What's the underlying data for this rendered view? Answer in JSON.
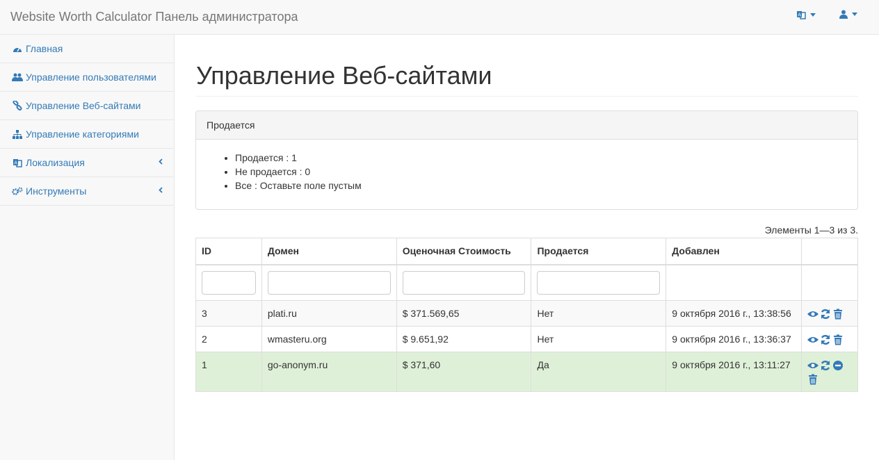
{
  "header": {
    "brand": "Website Worth Calculator Панель администратора"
  },
  "sidebar": {
    "items": [
      {
        "label": "Главная",
        "icon": "dashboard-icon"
      },
      {
        "label": "Управление пользователями",
        "icon": "users-icon"
      },
      {
        "label": "Управление Веб-сайтами",
        "icon": "link-icon"
      },
      {
        "label": "Управление категориями",
        "icon": "sitemap-icon"
      },
      {
        "label": "Локализация",
        "icon": "language-icon"
      },
      {
        "label": "Инструменты",
        "icon": "tools-icon"
      }
    ]
  },
  "main": {
    "title": "Управление Веб-сайтами",
    "panel": {
      "heading": "Продается",
      "items": [
        "Продается : 1",
        "Не продается : 0",
        "Все : Оставьте поле пустым"
      ]
    },
    "summary": "Элементы 1—3 из 3.",
    "table": {
      "columns": [
        "ID",
        "Домен",
        "Оценочная Стоимость",
        "Продается",
        "Добавлен"
      ],
      "rows": [
        {
          "id": "3",
          "domain": "plati.ru",
          "value": "$ 371.569,65",
          "sale": "Нет",
          "added": "9 октября 2016 г., 13:38:56"
        },
        {
          "id": "2",
          "domain": "wmasteru.org",
          "value": "$ 9.651,92",
          "sale": "Нет",
          "added": "9 октября 2016 г., 13:36:37"
        },
        {
          "id": "1",
          "domain": "go-anonym.ru",
          "value": "$ 371,60",
          "sale": "Да",
          "added": "9 октября 2016 г., 13:11:27"
        }
      ]
    }
  },
  "colors": {
    "link": "#337ab7",
    "success_row": "#dff0d8"
  }
}
